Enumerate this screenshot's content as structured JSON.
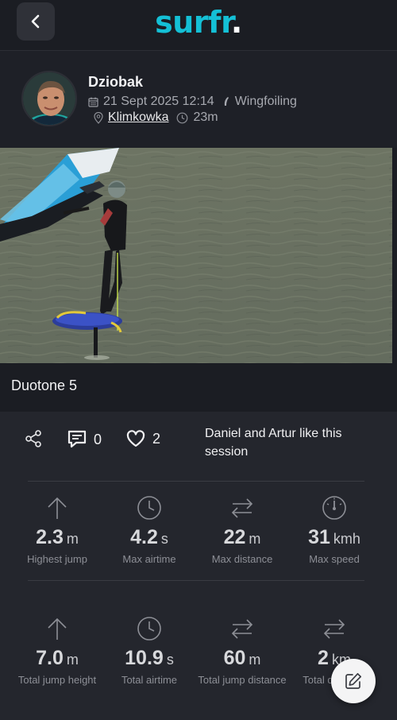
{
  "header": {
    "logo_brand": "surfr",
    "logo_dot": ".",
    "back_icon": "chevron-left-icon"
  },
  "profile": {
    "name": "Dziobak",
    "date": "21 Sept 2025 12:14",
    "sport": "Wingfoiling",
    "location": "Klimkowka",
    "duration": "23m"
  },
  "session": {
    "gear_title": "Duotone 5"
  },
  "actions": {
    "comments_count": "0",
    "likes_count": "2",
    "likes_text": "Daniel and Artur like this session"
  },
  "stats_top": [
    {
      "icon": "arrow-up-icon",
      "value": "2.3",
      "unit": "m",
      "label": "Highest jump"
    },
    {
      "icon": "clock-icon",
      "value": "4.2",
      "unit": "s",
      "label": "Max airtime"
    },
    {
      "icon": "arrows-swap-icon",
      "value": "22",
      "unit": "m",
      "label": "Max distance"
    },
    {
      "icon": "speedometer-icon",
      "value": "31",
      "unit": "kmh",
      "label": "Max speed"
    }
  ],
  "stats_bottom": [
    {
      "icon": "arrow-up-icon",
      "value": "7.0",
      "unit": "m",
      "label": "Total jump height"
    },
    {
      "icon": "clock-icon",
      "value": "10.9",
      "unit": "s",
      "label": "Total airtime"
    },
    {
      "icon": "arrows-swap-icon",
      "value": "60",
      "unit": "m",
      "label": "Total jump distance"
    },
    {
      "icon": "arrows-swap-icon",
      "value": "2",
      "unit": "km",
      "label": "Total distance"
    }
  ],
  "fab": {
    "icon": "edit-icon"
  },
  "colors": {
    "brand": "#14c0d6",
    "background": "#1b1d23",
    "panel": "#24262d"
  }
}
